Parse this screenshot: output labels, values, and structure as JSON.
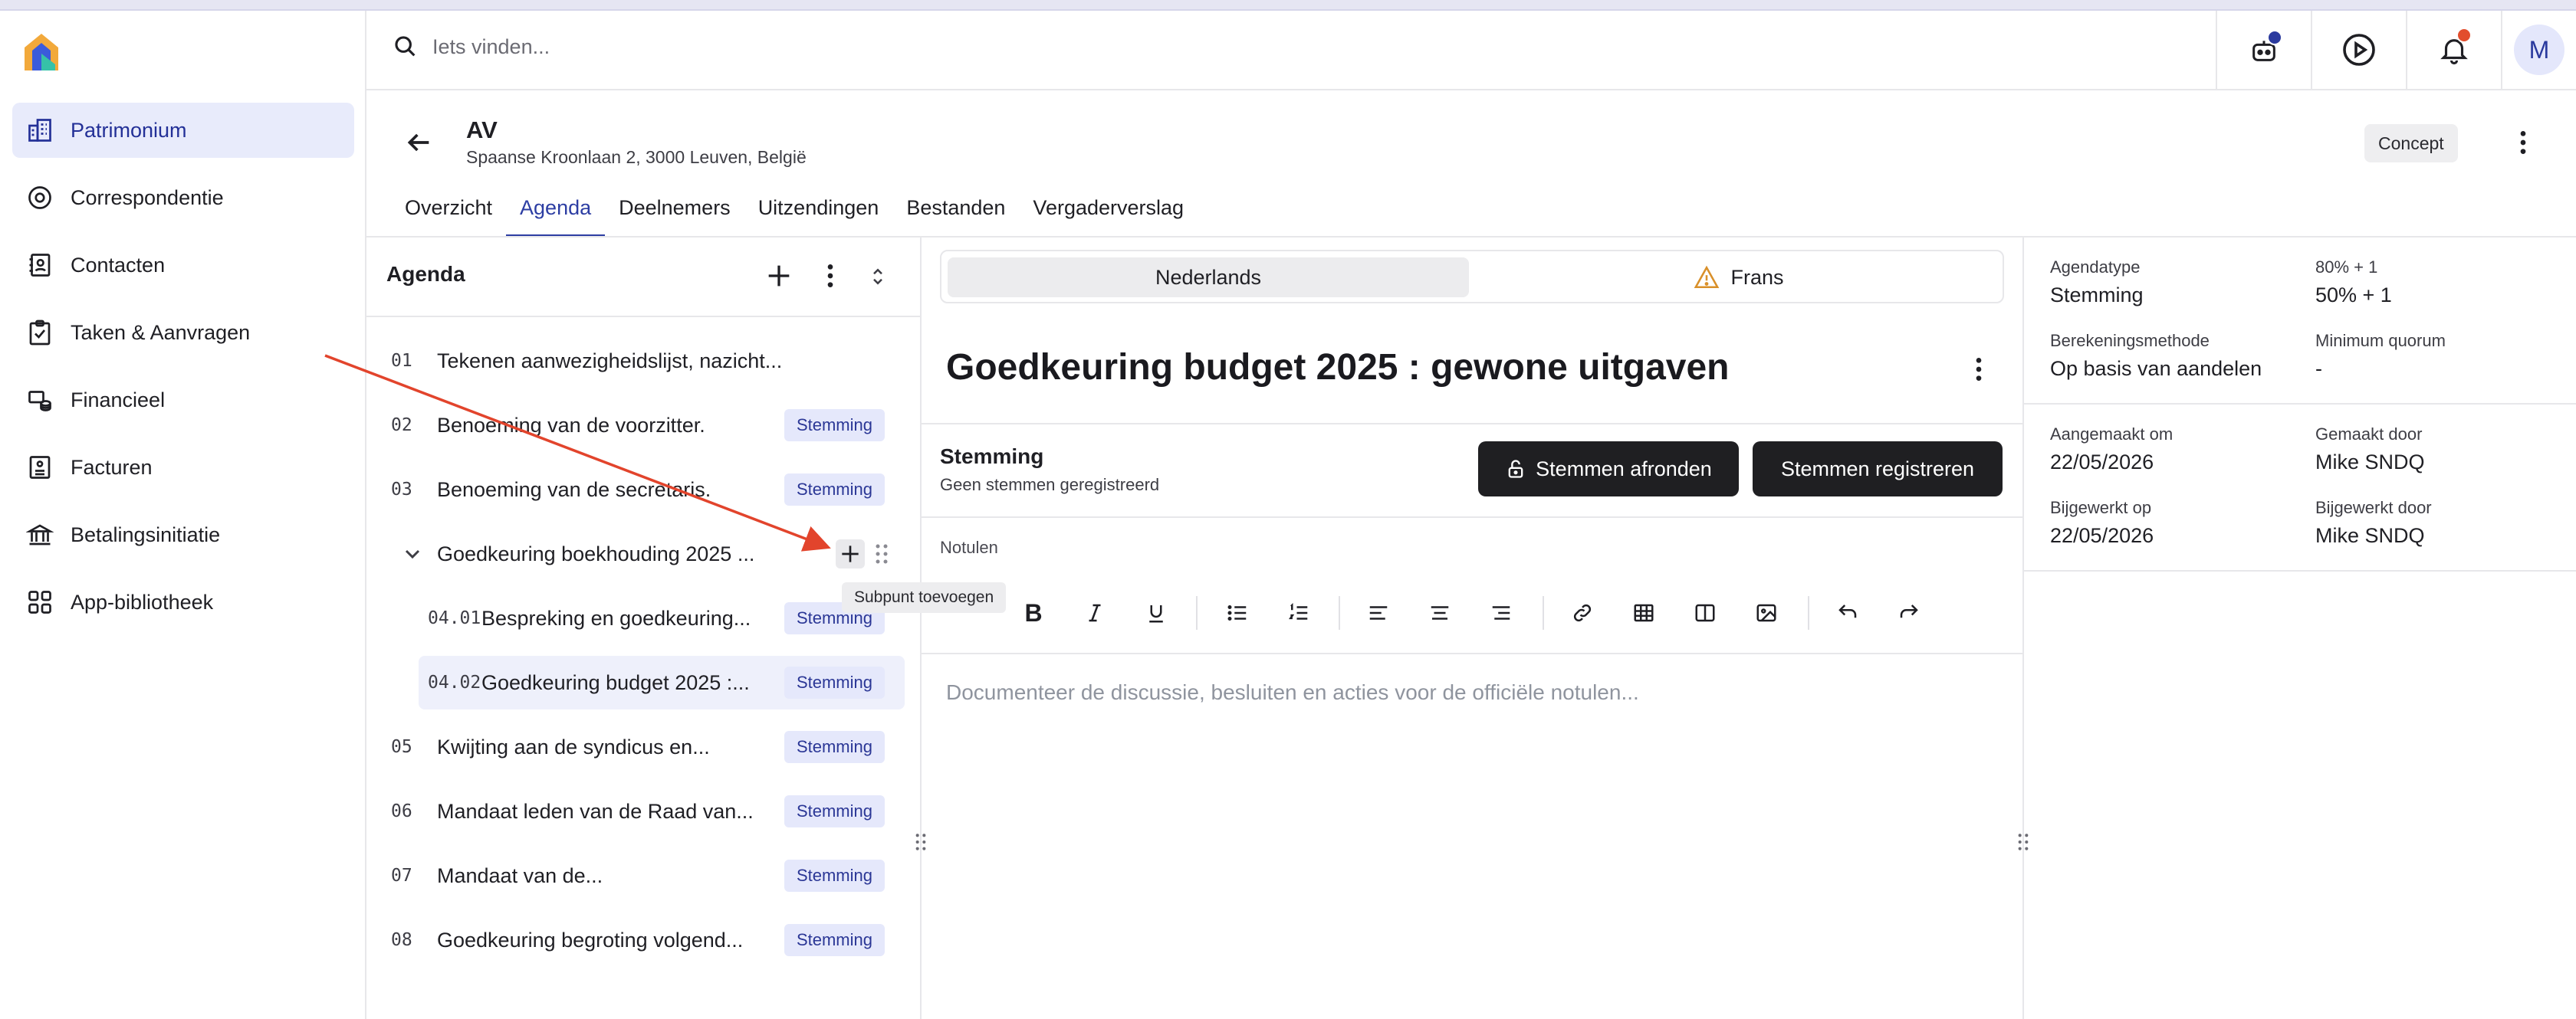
{
  "search": {
    "placeholder": "Iets vinden..."
  },
  "nav": [
    {
      "label": "Patrimonium",
      "active": true
    },
    {
      "label": "Correspondentie"
    },
    {
      "label": "Contacten"
    },
    {
      "label": "Taken & Aanvragen"
    },
    {
      "label": "Financieel"
    },
    {
      "label": "Facturen"
    },
    {
      "label": "Betalingsinitiatie"
    },
    {
      "label": "App-bibliotheek"
    }
  ],
  "user": {
    "initial": "M"
  },
  "page": {
    "title": "AV",
    "address": "Spaanse Kroonlaan 2, 3000 Leuven, België",
    "status": "Concept"
  },
  "tabs": [
    "Overzicht",
    "Agenda",
    "Deelnemers",
    "Uitzendingen",
    "Bestanden",
    "Vergaderverslag"
  ],
  "agenda": {
    "heading": "Agenda",
    "items": [
      {
        "num": "01",
        "text": "Tekenen aanwezigheidslijst, nazicht...",
        "badge": ""
      },
      {
        "num": "02",
        "text": "Benoeming van de voorzitter.",
        "badge": "Stemming"
      },
      {
        "num": "03",
        "text": "Benoeming van de secretaris.",
        "badge": "Stemming"
      },
      {
        "num": "",
        "text": "Goedkeuring boekhouding 2025 ...",
        "badge": ""
      },
      {
        "num": "04.01",
        "text": "Bespreking en goedkeuring...",
        "badge": "Stemming"
      },
      {
        "num": "04.02",
        "text": "Goedkeuring budget 2025 :...",
        "badge": "Stemming"
      },
      {
        "num": "05",
        "text": "Kwijting aan de syndicus en...",
        "badge": "Stemming"
      },
      {
        "num": "06",
        "text": "Mandaat leden van de Raad van...",
        "badge": "Stemming"
      },
      {
        "num": "07",
        "text": "Mandaat van de...",
        "badge": "Stemming"
      },
      {
        "num": "08",
        "text": "Goedkeuring begroting volgend...",
        "badge": "Stemming"
      }
    ],
    "tooltip": "Subpunt toevoegen"
  },
  "languages": {
    "primary": "Nederlands",
    "secondary": "Frans"
  },
  "detail": {
    "title": "Goedkeuring budget 2025 : gewone uitgaven",
    "vote_label": "Stemming",
    "vote_status": "Geen stemmen geregistreerd",
    "btn_finish": "Stemmen afronden",
    "btn_register": "Stemmen registreren",
    "notes_label": "Notulen",
    "editor_placeholder": "Documenteer de discussie, besluiten en acties voor de officiële notulen..."
  },
  "meta": {
    "agendatype_label": "Agendatype",
    "agendatype_value": "Stemming",
    "majority_label": "80% + 1",
    "majority_value": "50% + 1",
    "method_label": "Berekeningsmethode",
    "method_value": "Op basis van aandelen",
    "quorum_label": "Minimum quorum",
    "quorum_value": "-",
    "created_label": "Aangemaakt om",
    "created_value": "22/05/2026",
    "created_by_label": "Gemaakt door",
    "created_by_value": "Mike SNDQ",
    "updated_label": "Bijgewerkt op",
    "updated_value": "22/05/2026",
    "updated_by_label": "Bijgewerkt door",
    "updated_by_value": "Mike SNDQ"
  },
  "colors": {
    "accent": "#2d3ea3",
    "badge_bg": "#e5e8fb",
    "dark_button": "#1f1f22",
    "annotation_arrow": "#e2442c"
  }
}
